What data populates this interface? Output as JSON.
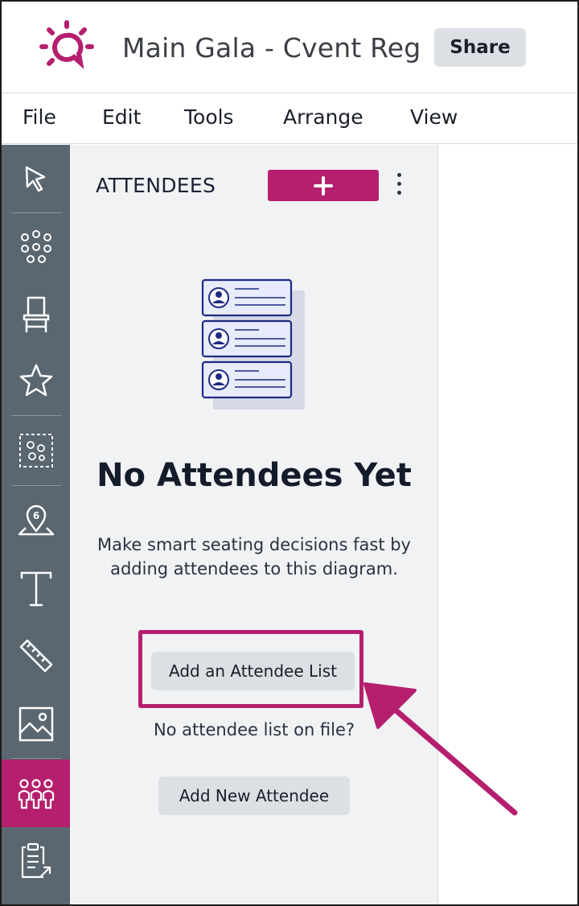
{
  "app": {
    "title": "Main Gala - Cvent Reg",
    "share_label": "Share",
    "logo_icon": "cvent-lightbulb-logo-icon",
    "brand_color": "#b51f6e"
  },
  "menu": {
    "items": [
      {
        "label": "File"
      },
      {
        "label": "Edit"
      },
      {
        "label": "Tools"
      },
      {
        "label": "Arrange"
      },
      {
        "label": "View"
      }
    ]
  },
  "toolbar": {
    "tools": [
      {
        "icon": "pointer-icon"
      },
      {
        "icon": "round-table-icon"
      },
      {
        "icon": "chair-icon"
      },
      {
        "icon": "star-icon"
      },
      {
        "icon": "group-select-icon"
      },
      {
        "icon": "location-pin-icon",
        "badge": "6"
      },
      {
        "icon": "text-icon"
      },
      {
        "icon": "ruler-icon"
      },
      {
        "icon": "image-icon"
      },
      {
        "icon": "attendees-icon",
        "active": true
      },
      {
        "icon": "clipboard-export-icon"
      }
    ]
  },
  "panel": {
    "title": "ATTENDEES",
    "add_icon": "plus-icon",
    "more_icon": "more-vertical-icon",
    "empty_state": {
      "illustration": "attendee-cards-illustration",
      "heading": "No Attendees Yet",
      "text": "Make smart seating decisions fast by adding attendees to this diagram.",
      "add_list_label": "Add an Attendee List",
      "no_list_text": "No attendee list on file?",
      "add_new_label": "Add New Attendee"
    }
  }
}
